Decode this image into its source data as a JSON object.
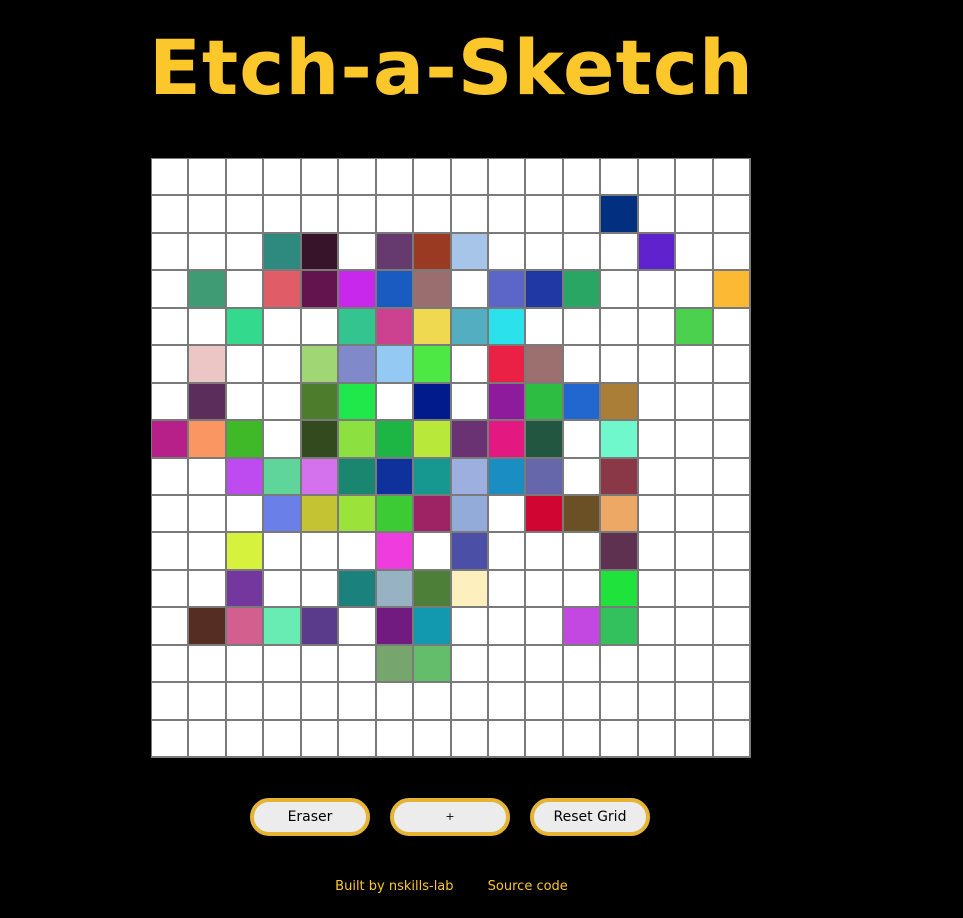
{
  "header": {
    "title": "Etch-a-Sketch"
  },
  "grid": {
    "rows": 16,
    "cols": 16,
    "default_color": "#ffffff",
    "line_color": "#7a7a7a",
    "cells": [
      {
        "r": 1,
        "c": 12,
        "color": "#022f7f"
      },
      {
        "r": 2,
        "c": 3,
        "color": "#2e8a7f"
      },
      {
        "r": 2,
        "c": 4,
        "color": "#37142a"
      },
      {
        "r": 2,
        "c": 6,
        "color": "#673a6f"
      },
      {
        "r": 2,
        "c": 7,
        "color": "#9b3a22"
      },
      {
        "r": 2,
        "c": 8,
        "color": "#a6c5e9"
      },
      {
        "r": 2,
        "c": 13,
        "color": "#5f22cd"
      },
      {
        "r": 3,
        "c": 1,
        "color": "#3f9b73"
      },
      {
        "r": 3,
        "c": 3,
        "color": "#e05d68"
      },
      {
        "r": 3,
        "c": 4,
        "color": "#63144e"
      },
      {
        "r": 3,
        "c": 5,
        "color": "#c728ec"
      },
      {
        "r": 3,
        "c": 6,
        "color": "#1a5bc2"
      },
      {
        "r": 3,
        "c": 7,
        "color": "#9a6d6f"
      },
      {
        "r": 3,
        "c": 9,
        "color": "#5c65c8"
      },
      {
        "r": 3,
        "c": 10,
        "color": "#1f38a3"
      },
      {
        "r": 3,
        "c": 11,
        "color": "#29a564"
      },
      {
        "r": 3,
        "c": 15,
        "color": "#fbb934"
      },
      {
        "r": 4,
        "c": 2,
        "color": "#33d98d"
      },
      {
        "r": 4,
        "c": 5,
        "color": "#33c490"
      },
      {
        "r": 4,
        "c": 6,
        "color": "#cc4291"
      },
      {
        "r": 4,
        "c": 7,
        "color": "#efd950"
      },
      {
        "r": 4,
        "c": 8,
        "color": "#52aec0"
      },
      {
        "r": 4,
        "c": 9,
        "color": "#2be2ec"
      },
      {
        "r": 4,
        "c": 14,
        "color": "#4cd14e"
      },
      {
        "r": 5,
        "c": 1,
        "color": "#ecc5c5"
      },
      {
        "r": 5,
        "c": 4,
        "color": "#a1d674"
      },
      {
        "r": 5,
        "c": 5,
        "color": "#8089ca"
      },
      {
        "r": 5,
        "c": 6,
        "color": "#93c9f3"
      },
      {
        "r": 5,
        "c": 7,
        "color": "#4ee845"
      },
      {
        "r": 5,
        "c": 9,
        "color": "#ea2045"
      },
      {
        "r": 5,
        "c": 10,
        "color": "#9c706f"
      },
      {
        "r": 6,
        "c": 1,
        "color": "#5a2d5a"
      },
      {
        "r": 6,
        "c": 4,
        "color": "#4d7c2c"
      },
      {
        "r": 6,
        "c": 5,
        "color": "#20e84b"
      },
      {
        "r": 6,
        "c": 7,
        "color": "#011a8c"
      },
      {
        "r": 6,
        "c": 9,
        "color": "#8e1b9b"
      },
      {
        "r": 6,
        "c": 10,
        "color": "#2ebd43"
      },
      {
        "r": 6,
        "c": 11,
        "color": "#2266cf"
      },
      {
        "r": 6,
        "c": 12,
        "color": "#ab7e38"
      },
      {
        "r": 7,
        "c": 0,
        "color": "#b72088"
      },
      {
        "r": 7,
        "c": 1,
        "color": "#f99661"
      },
      {
        "r": 7,
        "c": 2,
        "color": "#40b928"
      },
      {
        "r": 7,
        "c": 4,
        "color": "#334a1f"
      },
      {
        "r": 7,
        "c": 5,
        "color": "#8ce140"
      },
      {
        "r": 7,
        "c": 6,
        "color": "#1db644"
      },
      {
        "r": 7,
        "c": 7,
        "color": "#b8e83a"
      },
      {
        "r": 7,
        "c": 8,
        "color": "#6a3173"
      },
      {
        "r": 7,
        "c": 9,
        "color": "#e41881"
      },
      {
        "r": 7,
        "c": 10,
        "color": "#235640"
      },
      {
        "r": 7,
        "c": 12,
        "color": "#6ff8cb"
      },
      {
        "r": 8,
        "c": 2,
        "color": "#be4bef"
      },
      {
        "r": 8,
        "c": 3,
        "color": "#5fd59c"
      },
      {
        "r": 8,
        "c": 4,
        "color": "#d372ec"
      },
      {
        "r": 8,
        "c": 5,
        "color": "#1b8670"
      },
      {
        "r": 8,
        "c": 6,
        "color": "#0e319c"
      },
      {
        "r": 8,
        "c": 7,
        "color": "#169790"
      },
      {
        "r": 8,
        "c": 8,
        "color": "#9cafde"
      },
      {
        "r": 8,
        "c": 9,
        "color": "#1a8dc3"
      },
      {
        "r": 8,
        "c": 10,
        "color": "#6666aa"
      },
      {
        "r": 8,
        "c": 12,
        "color": "#8a3747"
      },
      {
        "r": 9,
        "c": 3,
        "color": "#6b7fe8"
      },
      {
        "r": 9,
        "c": 4,
        "color": "#c3c334"
      },
      {
        "r": 9,
        "c": 5,
        "color": "#9be33a"
      },
      {
        "r": 9,
        "c": 6,
        "color": "#3ccb34"
      },
      {
        "r": 9,
        "c": 7,
        "color": "#9d2365"
      },
      {
        "r": 9,
        "c": 8,
        "color": "#93abd8"
      },
      {
        "r": 9,
        "c": 10,
        "color": "#d00532"
      },
      {
        "r": 9,
        "c": 11,
        "color": "#6b4f25"
      },
      {
        "r": 9,
        "c": 12,
        "color": "#eea866"
      },
      {
        "r": 10,
        "c": 2,
        "color": "#d6f23d"
      },
      {
        "r": 10,
        "c": 6,
        "color": "#ee3cdf"
      },
      {
        "r": 10,
        "c": 8,
        "color": "#4b4fa5"
      },
      {
        "r": 10,
        "c": 12,
        "color": "#5e3150"
      },
      {
        "r": 11,
        "c": 2,
        "color": "#73379e"
      },
      {
        "r": 11,
        "c": 5,
        "color": "#1a817d"
      },
      {
        "r": 11,
        "c": 6,
        "color": "#97b3c3"
      },
      {
        "r": 11,
        "c": 7,
        "color": "#4d7f39"
      },
      {
        "r": 11,
        "c": 8,
        "color": "#fdefbe"
      },
      {
        "r": 11,
        "c": 12,
        "color": "#1fe23c"
      },
      {
        "r": 12,
        "c": 1,
        "color": "#552d23"
      },
      {
        "r": 12,
        "c": 2,
        "color": "#d25f8e"
      },
      {
        "r": 12,
        "c": 3,
        "color": "#68ecb4"
      },
      {
        "r": 12,
        "c": 4,
        "color": "#5a3b8b"
      },
      {
        "r": 12,
        "c": 6,
        "color": "#711a7f"
      },
      {
        "r": 12,
        "c": 7,
        "color": "#1299b0"
      },
      {
        "r": 12,
        "c": 11,
        "color": "#c348e2"
      },
      {
        "r": 12,
        "c": 12,
        "color": "#33c15e"
      },
      {
        "r": 13,
        "c": 6,
        "color": "#77a56e"
      },
      {
        "r": 13,
        "c": 7,
        "color": "#64bd6a"
      }
    ]
  },
  "controls": {
    "eraser_label": "Eraser",
    "plus_label": "+",
    "reset_label": "Reset Grid",
    "button_bg": "#ececec",
    "button_border": "#e5b434"
  },
  "footer": {
    "built_by": "Built by nskills-lab",
    "source_code": "Source code"
  },
  "theme": {
    "background": "#000000",
    "accent": "#fcc72b"
  }
}
